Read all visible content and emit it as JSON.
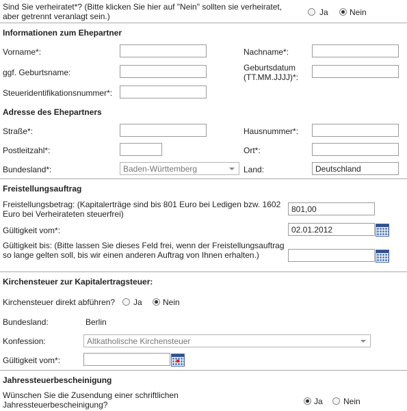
{
  "married": {
    "question": "Sind Sie verheiratet*? (Bitte klicken Sie hier auf \"Nein\" sollten sie verheiratet, aber getrennt veranlagt sein.)",
    "option_yes": "Ja",
    "option_no": "Nein",
    "selected": "Nein"
  },
  "partner": {
    "title": "Informationen zum Ehepartner",
    "vorname_label": "Vorname*:",
    "nachname_label": "Nachname*:",
    "geburtsname_label": "ggf. Geburtsname:",
    "geburtsdatum_label": "Geburtsdatum (TT.MM.JJJJ)*:",
    "steuerid_label": "Steueridentifikationsnummer*:",
    "vorname_value": "",
    "nachname_value": "",
    "geburtsname_value": "",
    "geburtsdatum_value": "",
    "steuerid_value": ""
  },
  "address": {
    "title": "Adresse des Ehepartners",
    "strasse_label": "Straße*:",
    "hausnummer_label": "Hausnummer*:",
    "plz_label": "Postleitzahl*:",
    "ort_label": "Ort*:",
    "bundesland_label": "Bundesland*:",
    "land_label": "Land:",
    "strasse_value": "",
    "hausnummer_value": "",
    "plz_value": "",
    "ort_value": "",
    "bundesland_value": "Baden-Württemberg",
    "land_value": "Deutschland"
  },
  "freistellung": {
    "title": "Freistellungsauftrag",
    "betrag_label": "Freistellungsbetrag: (Kapitalerträge sind bis 801 Euro bei Ledigen bzw. 1602 Euro bei Verheirateten steuerfrei)",
    "betrag_value": "801,00",
    "gueltig_von_label": "Gültigkeit vom*:",
    "gueltig_von_value": "02.01.2012",
    "gueltig_bis_label": "Gültigkeit bis: (Bitte lassen Sie dieses Feld frei, wenn der Freistellungsauftrag so lange gelten soll, bis wir einen anderen Auftrag von Ihnen erhalten.)",
    "gueltig_bis_value": ""
  },
  "kirchensteuer": {
    "title": "Kirchensteuer zur Kapitalertragsteuer:",
    "direkt_label": "Kirchensteuer direkt abführen?",
    "option_yes": "Ja",
    "option_no": "Nein",
    "selected": "Nein",
    "bundesland_label": "Bundesland:",
    "bundesland_value": "Berlin",
    "konfession_label": "Konfession:",
    "konfession_value": "Altkatholische Kirchensteuer",
    "gueltig_label": "Gültigkeit vom*:",
    "gueltig_value": ""
  },
  "jahressteuer": {
    "title": "Jahressteuerbescheinigung",
    "question": "Wünschen Sie die Zusendung einer schriftlichen Jahressteuerbescheinigung?",
    "option_yes": "Ja",
    "option_no": "Nein",
    "selected": "Ja"
  },
  "icons": {
    "calendar": "calendar-icon",
    "dropdown": "chevron-down-icon"
  }
}
